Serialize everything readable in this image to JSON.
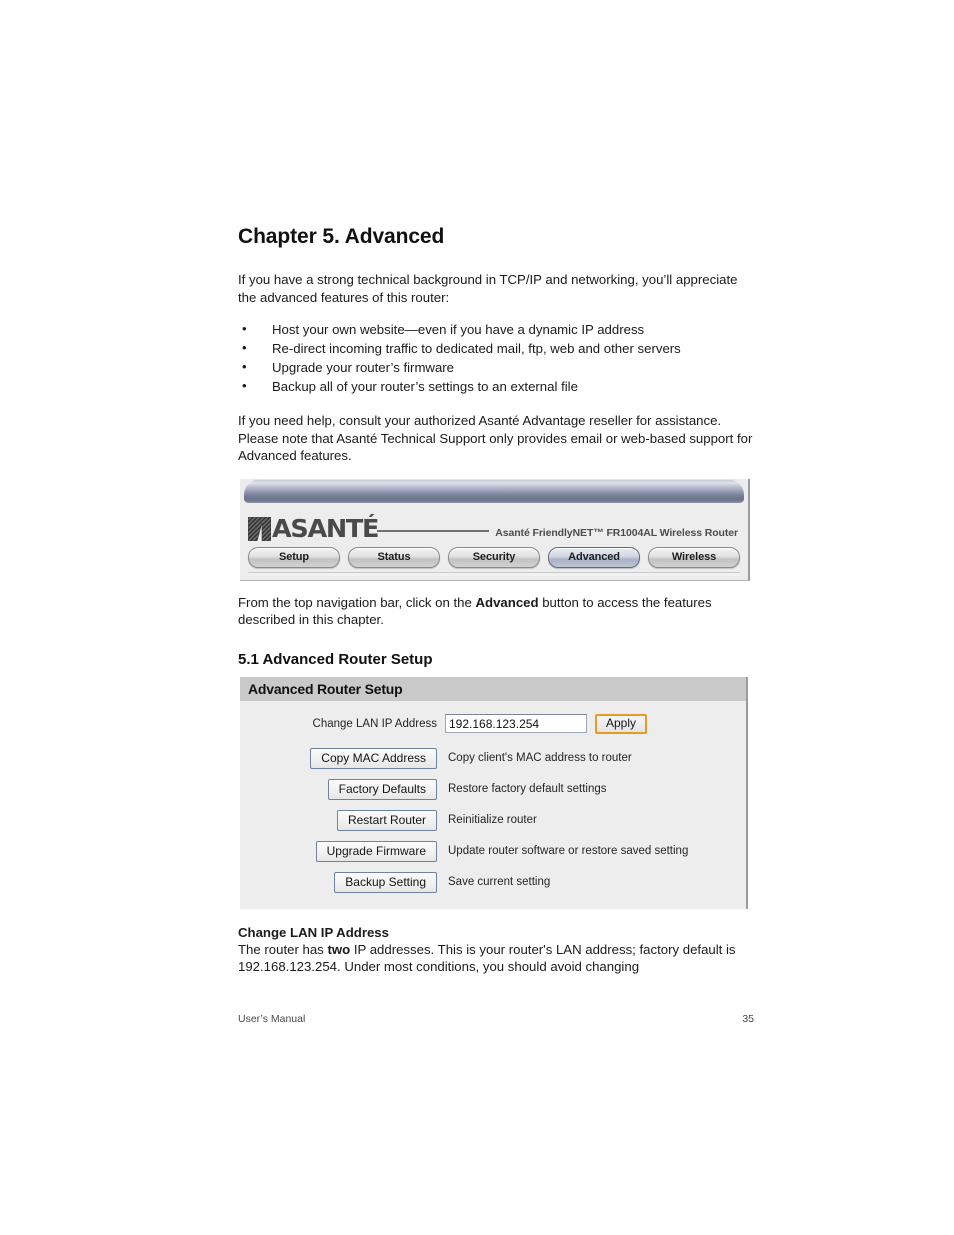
{
  "chapter": {
    "title": "Chapter 5. Advanced",
    "intro": "If you have a strong technical background in TCP/IP and networking, you’ll appreciate the advanced features of this router:",
    "bullets": [
      "Host your own website—even if you have a dynamic IP address",
      "Re-direct incoming traffic to dedicated mail, ftp, web and other servers",
      "Upgrade your router’s firmware",
      "Backup all of your router’s settings to an external file"
    ],
    "help_paragraph": "If you need help, consult your authorized Asanté Advantage reseller for assistance. Please note that Asanté Technical Support only provides email or web-based support for Advanced features.",
    "after_figure": {
      "part1": "From the top navigation bar, click on the ",
      "bold": "Advanced",
      "part2": " button to access the features described in this chapter."
    },
    "section_title": "5.1 Advanced Router Setup"
  },
  "router_nav": {
    "logo_text": "ASANTÉ",
    "model_text": "Asanté FriendlyNET™  FR1004AL Wireless Router",
    "buttons": [
      {
        "label": "Setup",
        "active": false
      },
      {
        "label": "Status",
        "active": false
      },
      {
        "label": "Security",
        "active": false
      },
      {
        "label": "Advanced",
        "active": true
      },
      {
        "label": "Wireless",
        "active": false
      }
    ]
  },
  "setup_panel": {
    "header": "Advanced Router Setup",
    "lan_ip": {
      "label": "Change LAN IP Address",
      "value": "192.168.123.254",
      "placeholder": "192.168.123.254",
      "apply_label": "Apply",
      "apply_border_color": "#e79b20"
    },
    "actions": [
      {
        "button": "Copy MAC Address",
        "description": "Copy client's MAC address to router"
      },
      {
        "button": "Factory Defaults",
        "description": "Restore factory default settings"
      },
      {
        "button": "Restart Router",
        "description": "Reinitialize router"
      },
      {
        "button": "Upgrade Firmware",
        "description": "Update router software or restore saved setting"
      },
      {
        "button": "Backup Setting",
        "description": "Save current setting"
      }
    ]
  },
  "lan_section": {
    "heading": "Change LAN IP Address",
    "text_part1": "The router has ",
    "text_bold": "two",
    "text_part2": " IP addresses. This is your router's LAN address; factory default is 192.168.123.254. Under most conditions, you should avoid changing"
  },
  "footer": {
    "left": "User’s Manual",
    "page_number": "35"
  }
}
